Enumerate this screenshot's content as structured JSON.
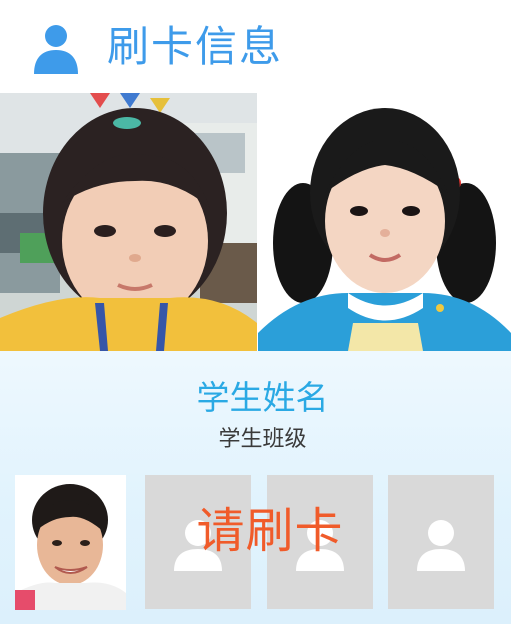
{
  "header": {
    "title": "刷卡信息",
    "icon": "person-icon",
    "accent_color": "#3e9bea"
  },
  "photos": [
    {
      "name": "student-photo-classroom",
      "description_icon": "portrait"
    },
    {
      "name": "student-photo-id",
      "description_icon": "portrait"
    }
  ],
  "student": {
    "name": "学生姓名",
    "class": "学生班级",
    "name_color": "#2aa9e4"
  },
  "prompt": {
    "text": "请刷卡",
    "color": "#f05b2a"
  },
  "slots": [
    {
      "icon": "avatar-placeholder-icon"
    },
    {
      "icon": "avatar-placeholder-icon"
    },
    {
      "icon": "avatar-placeholder-icon"
    }
  ]
}
